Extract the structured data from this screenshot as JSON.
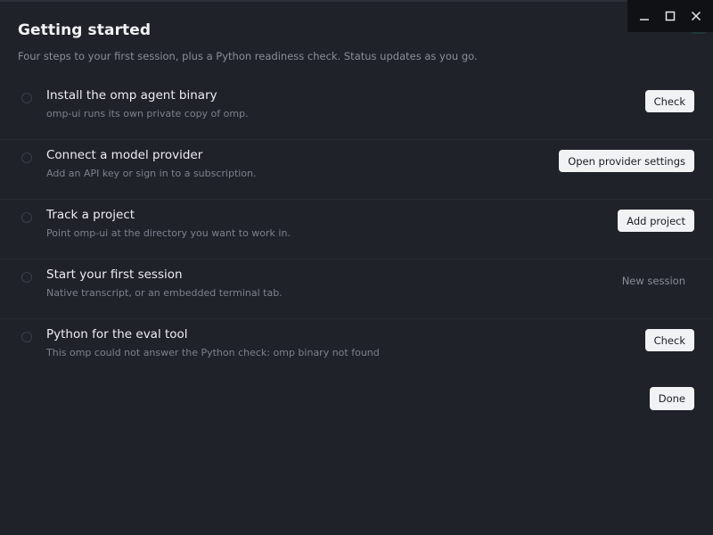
{
  "header": {
    "title": "Getting started",
    "subtitle": "Four steps to your first session, plus a Python readiness check. Status updates as you go."
  },
  "steps": [
    {
      "title": "Install the omp agent binary",
      "description": "omp-ui runs its own private copy of omp.",
      "button": "Check",
      "enabled": true
    },
    {
      "title": "Connect a model provider",
      "description": "Add an API key or sign in to a subscription.",
      "button": "Open provider settings",
      "enabled": true
    },
    {
      "title": "Track a project",
      "description": "Point omp-ui at the directory you want to work in.",
      "button": "Add project",
      "enabled": true
    },
    {
      "title": "Start your first session",
      "description": "Native transcript, or an embedded terminal tab.",
      "button": "New session",
      "enabled": false
    },
    {
      "title": "Python for the eval tool",
      "description": "This omp could not answer the Python check: omp binary not found",
      "button": "Check",
      "enabled": true
    }
  ],
  "footer": {
    "done_label": "Done"
  },
  "window_controls": [
    "minimize-icon",
    "maximize-icon",
    "close-icon"
  ],
  "colors": {
    "background": "#20222a",
    "button_bg": "#f1f2f4",
    "muted_text": "#7d818b"
  }
}
